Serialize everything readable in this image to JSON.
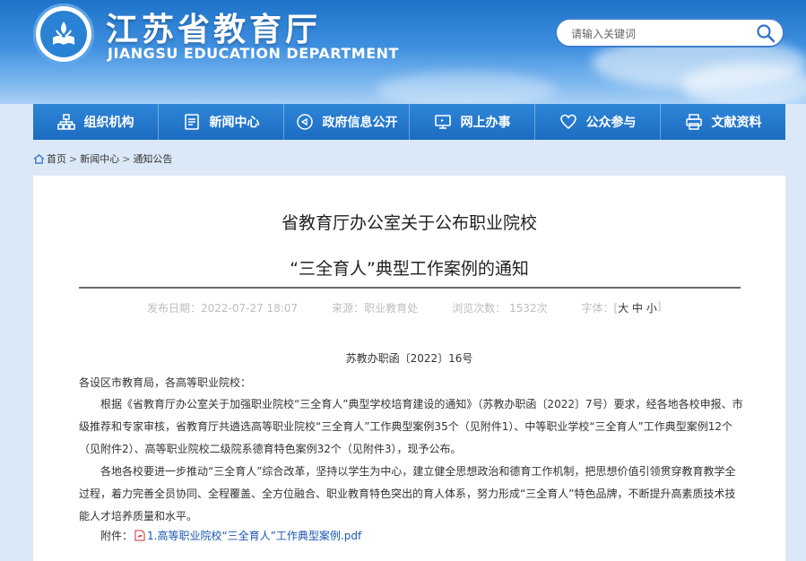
{
  "header": {
    "title": "江苏省教育厅",
    "subtitle": "JIANGSU EDUCATION DEPARTMENT",
    "search_placeholder": "请输入关键词"
  },
  "nav": [
    {
      "label": "组织机构",
      "icon": "org-chart-icon"
    },
    {
      "label": "新闻中心",
      "icon": "document-icon"
    },
    {
      "label": "政府信息公开",
      "icon": "megaphone-icon"
    },
    {
      "label": "网上办事",
      "icon": "monitor-icon"
    },
    {
      "label": "公众参与",
      "icon": "heart-icon"
    },
    {
      "label": "文献资料",
      "icon": "printer-icon"
    }
  ],
  "breadcrumb": {
    "home": "首页",
    "sep": ">",
    "level1": "新闻中心",
    "level2": "通知公告"
  },
  "article": {
    "title_line1": "省教育厅办公室关于公布职业院校",
    "title_line2": "“三全育人”典型工作案例的通知",
    "meta": {
      "date": "发布日期：2022-07-27 18:07",
      "source": "来源：职业教育处",
      "views": "浏览次数： 1532次",
      "fontsize_label": "字体：[",
      "fontsize_large": "大",
      "fontsize_medium": "中",
      "fontsize_small": "小",
      "fontsize_end": "]"
    },
    "doc_number": "苏教办职函〔2022〕16号",
    "greeting": "各设区市教育局，各高等职业院校：",
    "paragraph1": "根据《省教育厅办公室关于加强职业院校“三全育人”典型学校培育建设的通知》（苏教办职函〔2022〕7号）要求，经各地各校申报、市级推荐和专家审核，省教育厅共遴选高等职业院校“三全育人”工作典型案例35个（见附件1）、中等职业学校“三全育人”工作典型案例12个（见附件2）、高等职业院校二级院系德育特色案例32个（见附件3），现予公布。",
    "paragraph2": "各地各校要进一步推动“三全育人”综合改革，坚持以学生为中心，建立健全思想政治和德育工作机制，把思想价值引领贯穿教育教学全过程，着力完善全员协同、全程覆盖、全方位融合、职业教育特色突出的育人体系，努力形成“三全育人”特色品牌，不断提升高素质技术技能人才培养质量和水平。",
    "attachment_label": "附件：",
    "attachment_link": "1.高等职业院校“三全育人”工作典型案例.pdf"
  },
  "colors": {
    "nav_bg": "#1c6cc2",
    "banner_top": "#1e73c8",
    "link": "#1b57b3",
    "pdf_red": "#d42b2b"
  }
}
